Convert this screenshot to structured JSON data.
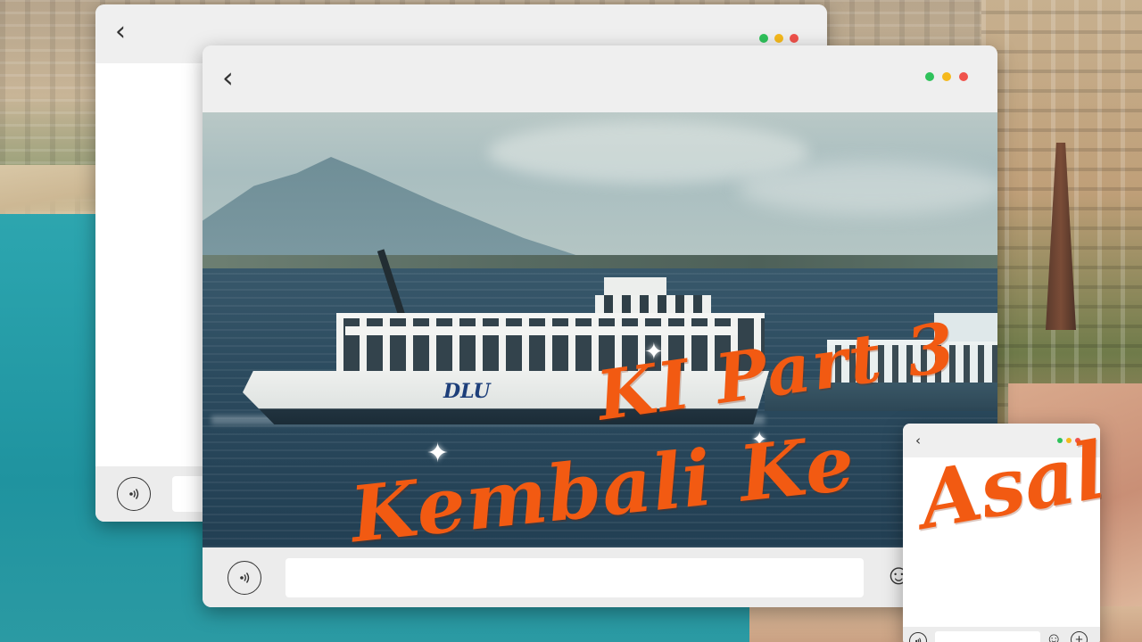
{
  "title": {
    "line1": "KI Part 3",
    "line2": "Kembali Ke",
    "line3": "Asal"
  },
  "photo": {
    "ferry_name": "DLU"
  },
  "icons": {
    "back": "chevron-left-icon",
    "audio": "speaker-wave-icon",
    "emoji": "smiley-face-icon",
    "add": "plus-circle-icon",
    "sparkle": "sparkle-icon"
  },
  "colors": {
    "title": "#f25a12",
    "dot_green": "#2fc25b",
    "dot_yellow": "#f5b91c",
    "dot_red": "#f0524b"
  }
}
